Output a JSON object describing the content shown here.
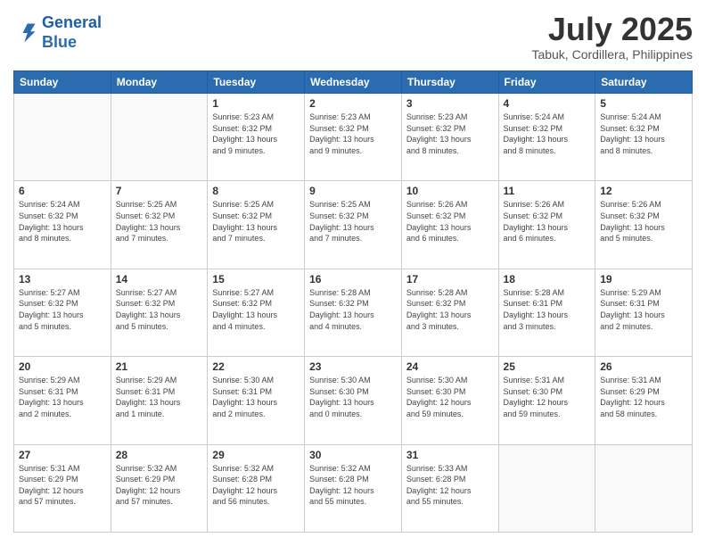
{
  "header": {
    "logo_line1": "General",
    "logo_line2": "Blue",
    "month": "July 2025",
    "location": "Tabuk, Cordillera, Philippines"
  },
  "weekdays": [
    "Sunday",
    "Monday",
    "Tuesday",
    "Wednesday",
    "Thursday",
    "Friday",
    "Saturday"
  ],
  "weeks": [
    [
      {
        "day": "",
        "info": ""
      },
      {
        "day": "",
        "info": ""
      },
      {
        "day": "1",
        "info": "Sunrise: 5:23 AM\nSunset: 6:32 PM\nDaylight: 13 hours\nand 9 minutes."
      },
      {
        "day": "2",
        "info": "Sunrise: 5:23 AM\nSunset: 6:32 PM\nDaylight: 13 hours\nand 9 minutes."
      },
      {
        "day": "3",
        "info": "Sunrise: 5:23 AM\nSunset: 6:32 PM\nDaylight: 13 hours\nand 8 minutes."
      },
      {
        "day": "4",
        "info": "Sunrise: 5:24 AM\nSunset: 6:32 PM\nDaylight: 13 hours\nand 8 minutes."
      },
      {
        "day": "5",
        "info": "Sunrise: 5:24 AM\nSunset: 6:32 PM\nDaylight: 13 hours\nand 8 minutes."
      }
    ],
    [
      {
        "day": "6",
        "info": "Sunrise: 5:24 AM\nSunset: 6:32 PM\nDaylight: 13 hours\nand 8 minutes."
      },
      {
        "day": "7",
        "info": "Sunrise: 5:25 AM\nSunset: 6:32 PM\nDaylight: 13 hours\nand 7 minutes."
      },
      {
        "day": "8",
        "info": "Sunrise: 5:25 AM\nSunset: 6:32 PM\nDaylight: 13 hours\nand 7 minutes."
      },
      {
        "day": "9",
        "info": "Sunrise: 5:25 AM\nSunset: 6:32 PM\nDaylight: 13 hours\nand 7 minutes."
      },
      {
        "day": "10",
        "info": "Sunrise: 5:26 AM\nSunset: 6:32 PM\nDaylight: 13 hours\nand 6 minutes."
      },
      {
        "day": "11",
        "info": "Sunrise: 5:26 AM\nSunset: 6:32 PM\nDaylight: 13 hours\nand 6 minutes."
      },
      {
        "day": "12",
        "info": "Sunrise: 5:26 AM\nSunset: 6:32 PM\nDaylight: 13 hours\nand 5 minutes."
      }
    ],
    [
      {
        "day": "13",
        "info": "Sunrise: 5:27 AM\nSunset: 6:32 PM\nDaylight: 13 hours\nand 5 minutes."
      },
      {
        "day": "14",
        "info": "Sunrise: 5:27 AM\nSunset: 6:32 PM\nDaylight: 13 hours\nand 5 minutes."
      },
      {
        "day": "15",
        "info": "Sunrise: 5:27 AM\nSunset: 6:32 PM\nDaylight: 13 hours\nand 4 minutes."
      },
      {
        "day": "16",
        "info": "Sunrise: 5:28 AM\nSunset: 6:32 PM\nDaylight: 13 hours\nand 4 minutes."
      },
      {
        "day": "17",
        "info": "Sunrise: 5:28 AM\nSunset: 6:32 PM\nDaylight: 13 hours\nand 3 minutes."
      },
      {
        "day": "18",
        "info": "Sunrise: 5:28 AM\nSunset: 6:31 PM\nDaylight: 13 hours\nand 3 minutes."
      },
      {
        "day": "19",
        "info": "Sunrise: 5:29 AM\nSunset: 6:31 PM\nDaylight: 13 hours\nand 2 minutes."
      }
    ],
    [
      {
        "day": "20",
        "info": "Sunrise: 5:29 AM\nSunset: 6:31 PM\nDaylight: 13 hours\nand 2 minutes."
      },
      {
        "day": "21",
        "info": "Sunrise: 5:29 AM\nSunset: 6:31 PM\nDaylight: 13 hours\nand 1 minute."
      },
      {
        "day": "22",
        "info": "Sunrise: 5:30 AM\nSunset: 6:31 PM\nDaylight: 13 hours\nand 2 minutes."
      },
      {
        "day": "23",
        "info": "Sunrise: 5:30 AM\nSunset: 6:30 PM\nDaylight: 13 hours\nand 0 minutes."
      },
      {
        "day": "24",
        "info": "Sunrise: 5:30 AM\nSunset: 6:30 PM\nDaylight: 12 hours\nand 59 minutes."
      },
      {
        "day": "25",
        "info": "Sunrise: 5:31 AM\nSunset: 6:30 PM\nDaylight: 12 hours\nand 59 minutes."
      },
      {
        "day": "26",
        "info": "Sunrise: 5:31 AM\nSunset: 6:29 PM\nDaylight: 12 hours\nand 58 minutes."
      }
    ],
    [
      {
        "day": "27",
        "info": "Sunrise: 5:31 AM\nSunset: 6:29 PM\nDaylight: 12 hours\nand 57 minutes."
      },
      {
        "day": "28",
        "info": "Sunrise: 5:32 AM\nSunset: 6:29 PM\nDaylight: 12 hours\nand 57 minutes."
      },
      {
        "day": "29",
        "info": "Sunrise: 5:32 AM\nSunset: 6:28 PM\nDaylight: 12 hours\nand 56 minutes."
      },
      {
        "day": "30",
        "info": "Sunrise: 5:32 AM\nSunset: 6:28 PM\nDaylight: 12 hours\nand 55 minutes."
      },
      {
        "day": "31",
        "info": "Sunrise: 5:33 AM\nSunset: 6:28 PM\nDaylight: 12 hours\nand 55 minutes."
      },
      {
        "day": "",
        "info": ""
      },
      {
        "day": "",
        "info": ""
      }
    ]
  ]
}
